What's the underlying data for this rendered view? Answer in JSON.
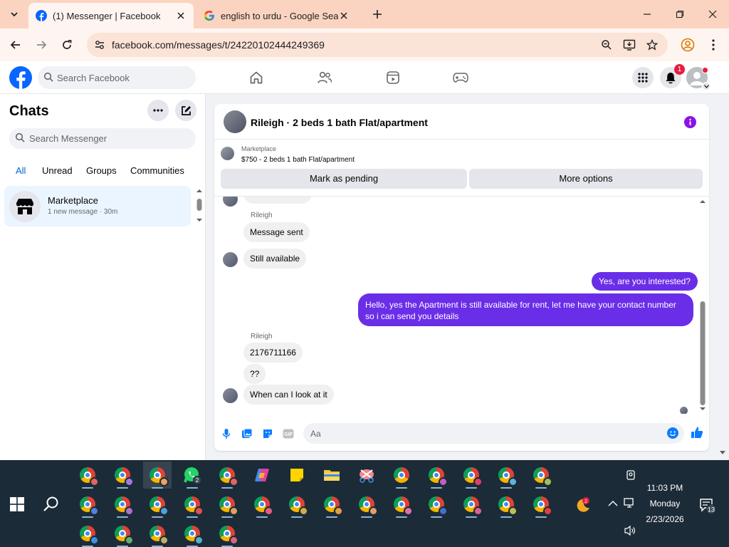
{
  "browser": {
    "tabs": [
      {
        "title": "(1) Messenger | Facebook",
        "active": true
      },
      {
        "title": "english to urdu - Google Search",
        "active": false
      }
    ],
    "url": "facebook.com/messages/t/24220102444249369"
  },
  "fb": {
    "search_placeholder": "Search Facebook",
    "notifications_count": "1"
  },
  "sidebar": {
    "title": "Chats",
    "search_placeholder": "Search Messenger",
    "filters": [
      "All",
      "Unread",
      "Groups",
      "Communities"
    ],
    "active_filter": "All",
    "chats": [
      {
        "name": "Marketplace",
        "preview": "1 new message · 30m"
      }
    ]
  },
  "conversation": {
    "title": "Rileigh · 2 beds 1 bath Flat/apartment",
    "listing": {
      "label": "Marketplace",
      "price_line": "$750 - 2 beds 1 bath Flat/apartment"
    },
    "actions": [
      "Mark as pending",
      "More options"
    ],
    "messages": [
      {
        "sender": "Rileigh",
        "from": "them",
        "text": "Message sent"
      },
      {
        "from": "them",
        "text": "Still available"
      },
      {
        "from": "me",
        "text": "Yes, are you interested?"
      },
      {
        "from": "me",
        "text": "Hello, yes the Apartment is still available for rent, let me have your contact number so i can send you details"
      },
      {
        "sender": "Rileigh",
        "from": "them",
        "text": "2176711166"
      },
      {
        "from": "them",
        "text": "??"
      },
      {
        "from": "them",
        "text": "When can I look at it"
      }
    ],
    "composer_placeholder": "Aa"
  },
  "taskbar": {
    "whatsapp_badge": "2",
    "weather_badge": "2",
    "time": "11:03 PM",
    "day": "Monday",
    "date": "2/23/2026",
    "notifications": "13"
  },
  "colors": {
    "messenger_purple": "#6a2ee8",
    "fb_blue": "#0866ff",
    "tab_strip": "#fad4c0",
    "taskbar": "#1c2b38"
  }
}
